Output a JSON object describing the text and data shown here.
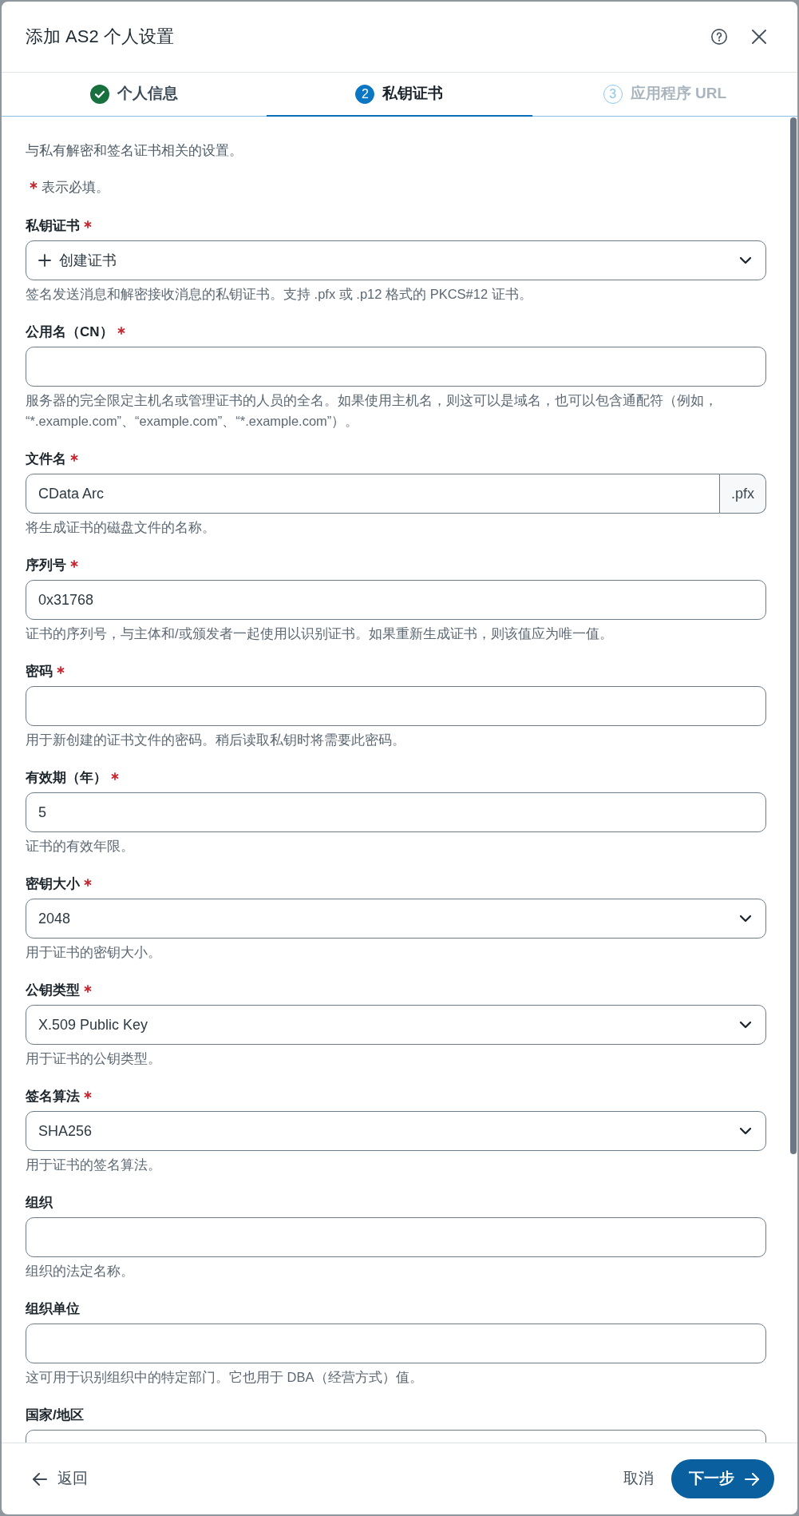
{
  "window": {
    "title": "添加 AS2 个人设置"
  },
  "tabs": [
    {
      "label": "个人信息",
      "completed": true,
      "selected": false,
      "disabled": false
    },
    {
      "number": "2",
      "label": "私钥证书",
      "completed": false,
      "selected": true,
      "disabled": false
    },
    {
      "number": "3",
      "label": "应用程序 URL",
      "completed": false,
      "selected": false,
      "disabled": true
    }
  ],
  "intro": "与私有解密和签名证书相关的设置。",
  "required_note": "表示必填。",
  "fields": [
    {
      "kind": "action",
      "label": "私钥证书",
      "required": true,
      "value": "创建证书",
      "help": "签名发送消息和解密接收消息的私钥证书。支持 .pfx 或 .p12 格式的 PKCS#12 证书。"
    },
    {
      "kind": "text",
      "label": "公用名（CN）",
      "required": true,
      "help": "服务器的完全限定主机名或管理证书的人员的全名。如果使用主机名，则这可以是域名，也可以包含通配符（例如，“*.example.com”、“example.com”、“*.example.com”）。"
    },
    {
      "kind": "addon",
      "label": "文件名",
      "required": true,
      "value": "CData Arc",
      "addon": ".pfx",
      "help": "将生成证书的磁盘文件的名称。"
    },
    {
      "kind": "text",
      "label": "序列号",
      "required": true,
      "value": "0x31768",
      "help": "证书的序列号，与主体和/或颁发者一起使用以识别证书。如果重新生成证书，则该值应为唯一值。"
    },
    {
      "kind": "text",
      "label": "密码",
      "required": true,
      "help": "用于新创建的证书文件的密码。稍后读取私钥时将需要此密码。"
    },
    {
      "kind": "text",
      "label": "有效期（年）",
      "required": true,
      "value": "5",
      "help": "证书的有效年限。"
    },
    {
      "kind": "select",
      "label": "密钥大小",
      "required": true,
      "value": "2048",
      "help": "用于证书的密钥大小。"
    },
    {
      "kind": "select",
      "label": "公钥类型",
      "required": true,
      "value": "X.509 Public Key",
      "help": "用于证书的公钥类型。"
    },
    {
      "kind": "select",
      "label": "签名算法",
      "required": true,
      "value": "SHA256",
      "help": "用于证书的签名算法。"
    },
    {
      "kind": "text",
      "label": "组织",
      "required": false,
      "help": "组织的法定名称。"
    },
    {
      "kind": "text",
      "label": "组织单位",
      "required": false,
      "help": "这可用于识别组织中的特定部门。它也用于 DBA（经营方式）值。"
    },
    {
      "kind": "text",
      "label": "国家/地区",
      "required": false
    }
  ],
  "footer": {
    "back": "返回",
    "cancel": "取消",
    "next": "下一步"
  }
}
